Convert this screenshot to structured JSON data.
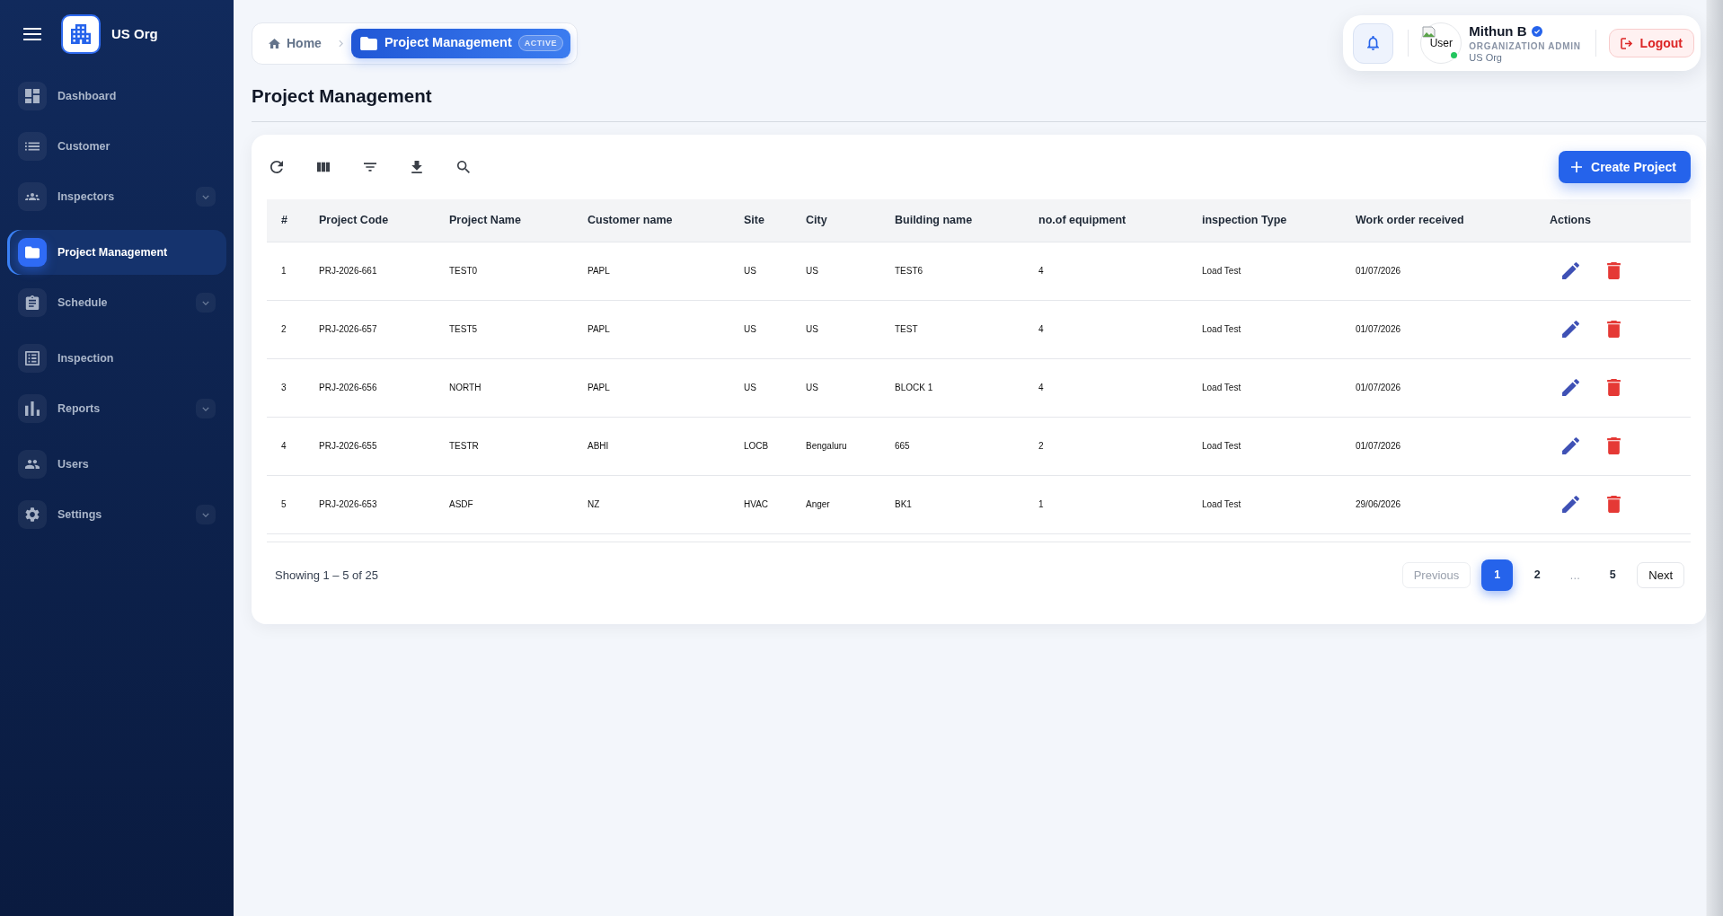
{
  "sidebar": {
    "org_name": "US Org",
    "items": [
      {
        "label": "Dashboard",
        "selected": false,
        "expandable": false
      },
      {
        "label": "Customer",
        "selected": false,
        "expandable": false
      },
      {
        "label": "Inspectors",
        "selected": false,
        "expandable": true
      },
      {
        "label": "Project Management",
        "selected": true,
        "expandable": false
      },
      {
        "label": "Schedule",
        "selected": false,
        "expandable": true
      },
      {
        "label": "Inspection",
        "selected": false,
        "expandable": false
      },
      {
        "label": "Reports",
        "selected": false,
        "expandable": true
      },
      {
        "label": "Users",
        "selected": false,
        "expandable": false
      },
      {
        "label": "Settings",
        "selected": false,
        "expandable": true
      }
    ]
  },
  "breadcrumb": [
    {
      "label": "Home",
      "selected": false
    },
    {
      "label": "Project Management",
      "selected": true,
      "badge": "ACTIVE"
    }
  ],
  "user": {
    "name": "Mithun B",
    "verified": true,
    "role": "ORGANIZATION ADMIN",
    "org": "US Org",
    "avatar_alt": "User",
    "online": true
  },
  "logout_label": "Logout",
  "page_title": "Project Management",
  "create_button": "Create Project",
  "table": {
    "columns": [
      "#",
      "Project Code",
      "Project Name",
      "Customer name",
      "Site",
      "City",
      "Building name",
      "no.of equipment",
      "inspection Type",
      "Work order received",
      "Actions"
    ],
    "rows": [
      {
        "cells": [
          "1",
          "PRJ-2026-661",
          "TEST0",
          "PAPL",
          "US",
          "US",
          "TEST6",
          "4",
          "Load Test",
          "01/07/2026"
        ]
      },
      {
        "cells": [
          "2",
          "PRJ-2026-657",
          "TEST5",
          "PAPL",
          "US",
          "US",
          "TEST",
          "4",
          "Load Test",
          "01/07/2026"
        ]
      },
      {
        "cells": [
          "3",
          "PRJ-2026-656",
          "NORTH",
          "PAPL",
          "US",
          "US",
          "BLOCK 1",
          "4",
          "Load Test",
          "01/07/2026"
        ]
      },
      {
        "cells": [
          "4",
          "PRJ-2026-655",
          "TESTR",
          "ABHI",
          "LOCB",
          "Bengaluru",
          "665",
          "2",
          "Load Test",
          "01/07/2026"
        ]
      },
      {
        "cells": [
          "5",
          "PRJ-2026-653",
          "ASDF",
          "NZ",
          "HVAC",
          "Anger",
          "BK1",
          "1",
          "Load Test",
          "29/06/2026"
        ]
      }
    ]
  },
  "footer": {
    "summary": "Showing 1 – 5 of 25",
    "pagination": [
      {
        "kind": "nav",
        "label": "Previous",
        "disabled": true
      },
      {
        "kind": "page",
        "label": "1",
        "selected": true
      },
      {
        "kind": "page",
        "label": "2",
        "selected": false
      },
      {
        "kind": "ellipsis",
        "label": "…"
      },
      {
        "kind": "page",
        "label": "5",
        "selected": false
      },
      {
        "kind": "nav",
        "label": "Next",
        "disabled": false
      }
    ]
  }
}
